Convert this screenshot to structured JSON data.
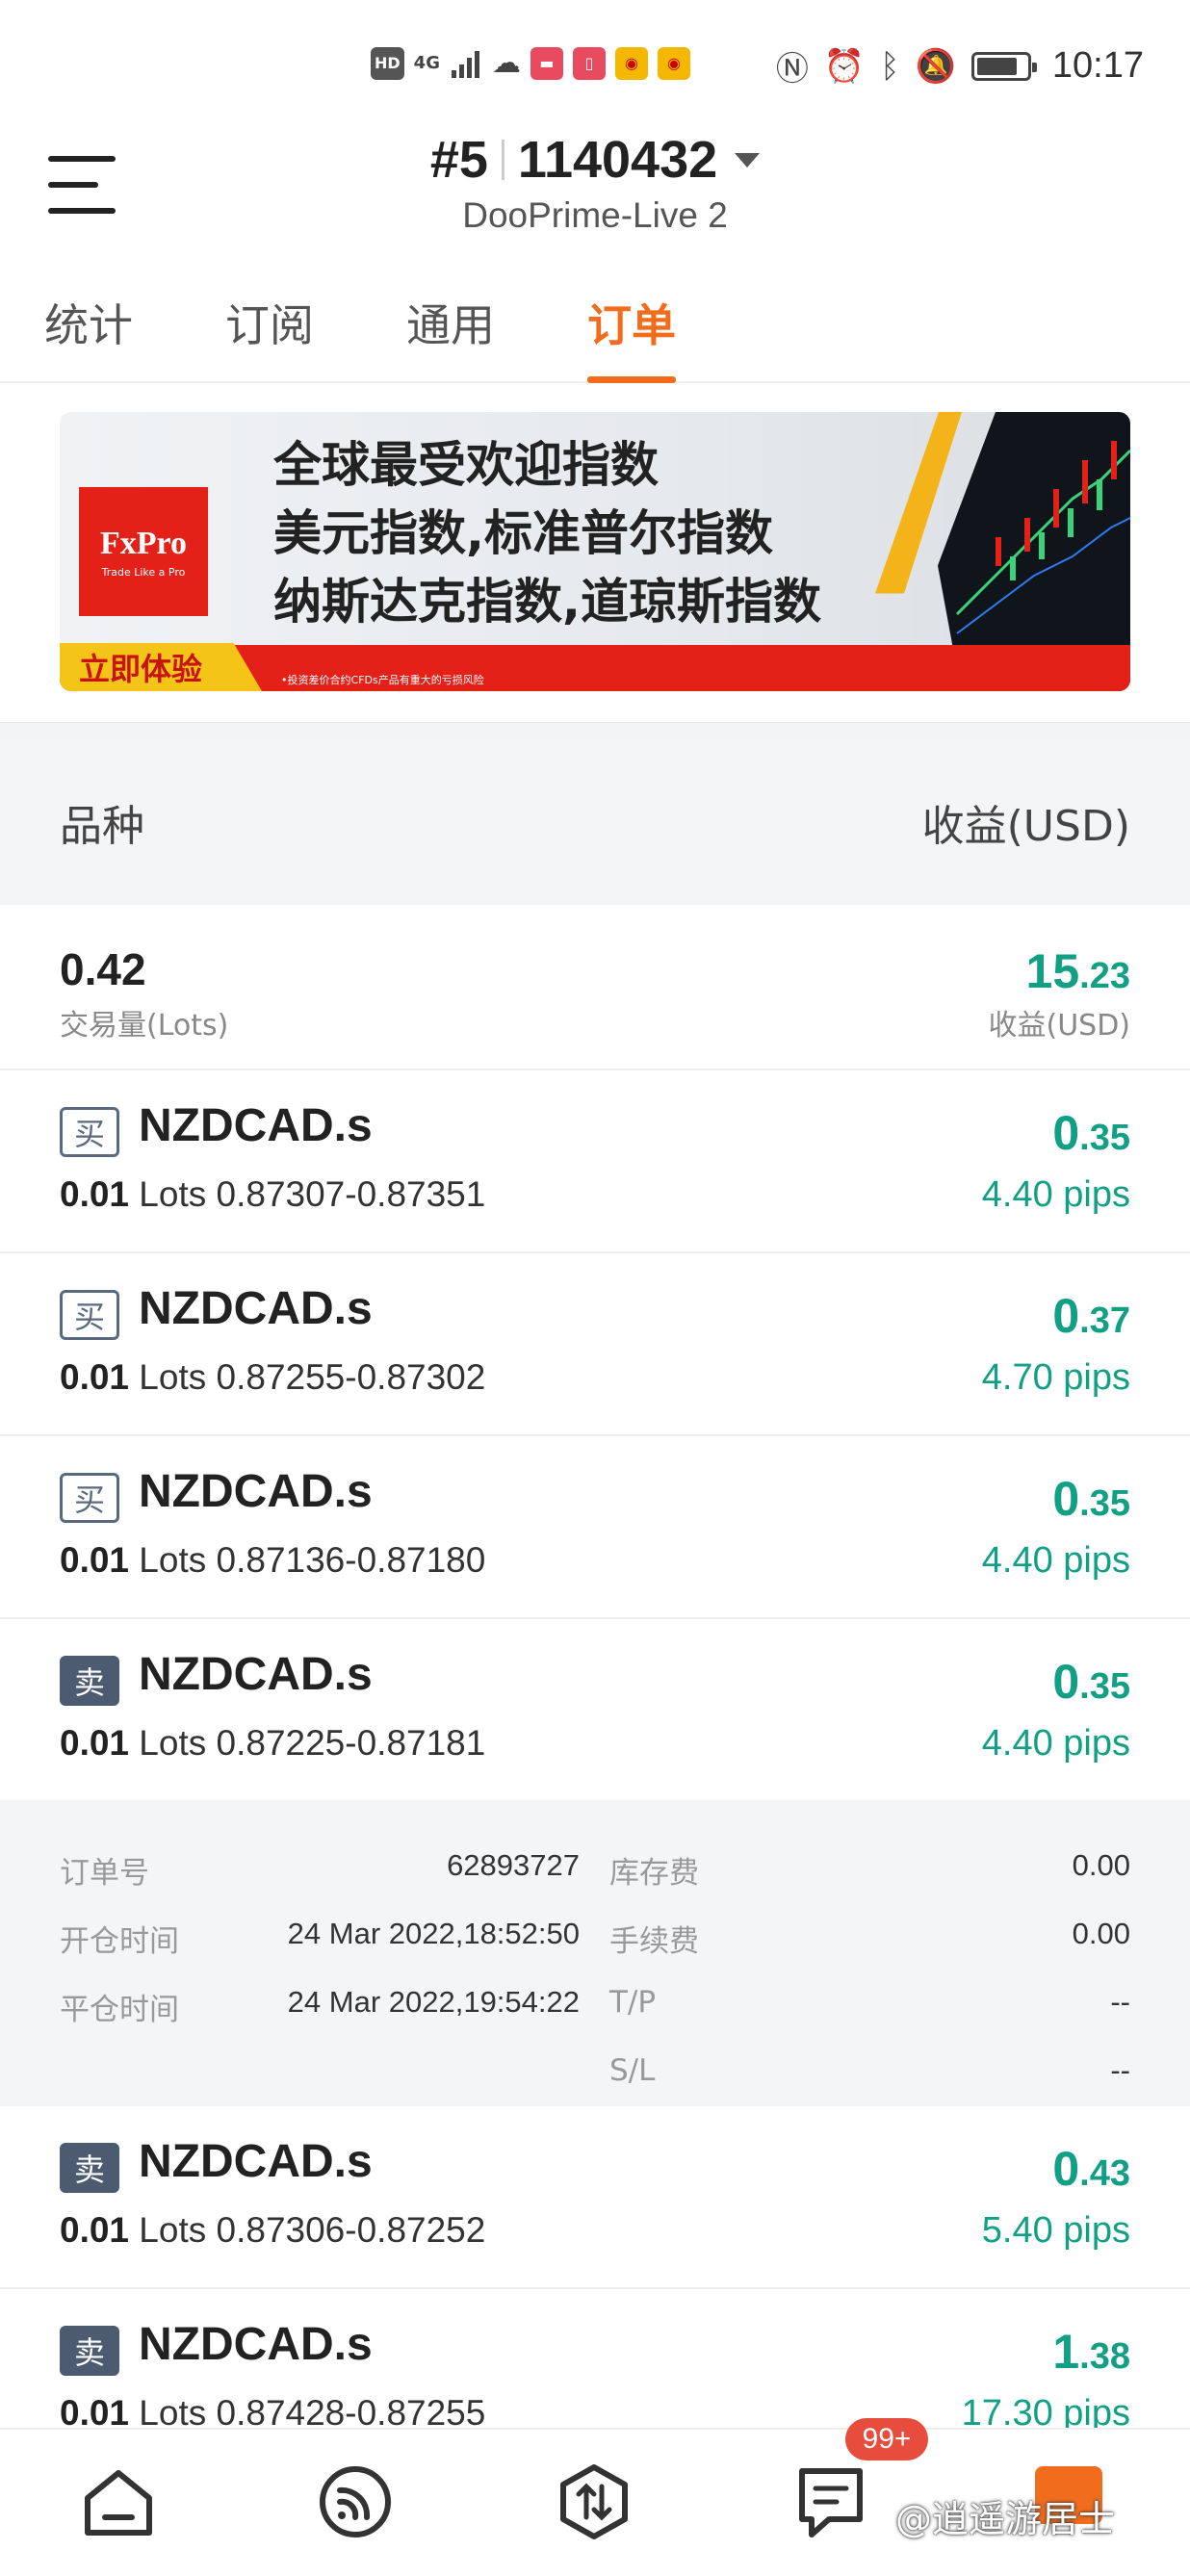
{
  "status_bar": {
    "left_icons": [
      "HD",
      "4G",
      "signal-bars-icon",
      "cloud-icon",
      "huawei-app-icon",
      "book-app-icon",
      "weibo-icon",
      "weibo-icon"
    ],
    "hd": "HD",
    "network": "4G",
    "right_icons": [
      "nfc-icon",
      "alarm-icon",
      "bluetooth-icon",
      "mute-icon",
      "battery-icon"
    ],
    "time": "10:17"
  },
  "header": {
    "account_index": "#5",
    "account_number": "1140432",
    "server": "DooPrime-Live 2"
  },
  "tabs": [
    {
      "label": "统计",
      "active": false
    },
    {
      "label": "订阅",
      "active": false
    },
    {
      "label": "通用",
      "active": false
    },
    {
      "label": "订单",
      "active": true
    }
  ],
  "banner": {
    "logo_text": "FxPro",
    "logo_tagline": "Trade Like a Pro",
    "line1": "全球最受欢迎指数",
    "line2": "美元指数,标准普尔指数",
    "line3": "纳斯达克指数,道琼斯指数",
    "cta": "立即体验",
    "risk_note": "•投资差价合约CFDs产品有重大的亏损风险"
  },
  "columns": {
    "left": "品种",
    "right": "收益(USD)"
  },
  "summary": {
    "volume": "0.42",
    "volume_label": "交易量(Lots)",
    "profit_int": "15",
    "profit_dec": ".23",
    "profit_label": "收益(USD)"
  },
  "orders": [
    {
      "side": "买",
      "type": "buy",
      "symbol": "NZDCAD.s",
      "lots": "0.01",
      "lots_unit": "Lots",
      "range": "0.87307-0.87351",
      "profit_int": "0",
      "profit_dec": ".35",
      "pips": "4.40 pips"
    },
    {
      "side": "买",
      "type": "buy",
      "symbol": "NZDCAD.s",
      "lots": "0.01",
      "lots_unit": "Lots",
      "range": "0.87255-0.87302",
      "profit_int": "0",
      "profit_dec": ".37",
      "pips": "4.70 pips"
    },
    {
      "side": "买",
      "type": "buy",
      "symbol": "NZDCAD.s",
      "lots": "0.01",
      "lots_unit": "Lots",
      "range": "0.87136-0.87180",
      "profit_int": "0",
      "profit_dec": ".35",
      "pips": "4.40 pips"
    },
    {
      "side": "卖",
      "type": "sell",
      "symbol": "NZDCAD.s",
      "lots": "0.01",
      "lots_unit": "Lots",
      "range": "0.87225-0.87181",
      "profit_int": "0",
      "profit_dec": ".35",
      "pips": "4.40 pips"
    },
    {
      "side": "卖",
      "type": "sell",
      "symbol": "NZDCAD.s",
      "lots": "0.01",
      "lots_unit": "Lots",
      "range": "0.87306-0.87252",
      "profit_int": "0",
      "profit_dec": ".43",
      "pips": "5.40 pips"
    },
    {
      "side": "卖",
      "type": "sell",
      "symbol": "NZDCAD.s",
      "lots": "0.01",
      "lots_unit": "Lots",
      "range": "0.87428-0.87255",
      "profit_int": "1",
      "profit_dec": ".38",
      "pips": "17.30 pips"
    }
  ],
  "order_detail": {
    "order_no_label": "订单号",
    "order_no": "62893727",
    "open_label": "开仓时间",
    "open_time": "24 Mar 2022,18:52:50",
    "close_label": "平仓时间",
    "close_time": "24 Mar 2022,19:54:22",
    "swap_label": "库存费",
    "swap": "0.00",
    "commission_label": "手续费",
    "commission": "0.00",
    "tp_label": "T/P",
    "tp": "--",
    "sl_label": "S/L",
    "sl": "--"
  },
  "bottom_nav": {
    "items": [
      "home-icon",
      "signal-feed-icon",
      "trade-icon",
      "messages-icon",
      "profile-icon"
    ],
    "badge": "99+",
    "watermark": "@逍遥游居士"
  },
  "colors": {
    "accent": "#f26c1d",
    "profit_green": "#12a085",
    "badge_sell": "#4d5b70",
    "badge_red": "#e74c3c"
  }
}
